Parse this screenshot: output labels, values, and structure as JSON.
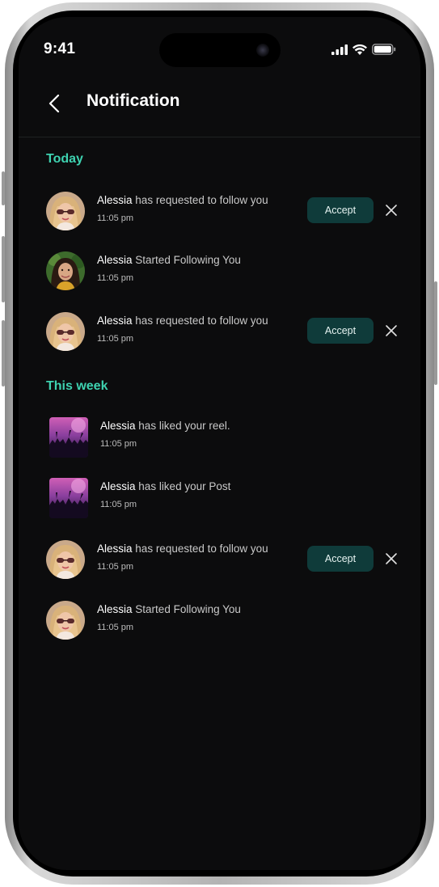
{
  "status_bar": {
    "time": "9:41"
  },
  "header": {
    "title": "Notification"
  },
  "sections": [
    {
      "title": "Today",
      "items": [
        {
          "name": "Alessia",
          "text": "has requested to follow you",
          "time": "11:05 pm",
          "accept_label": "Accept",
          "media": "avatar-blonde"
        },
        {
          "name": "Alessia",
          "text": "Started Following You",
          "time": "11:05 pm",
          "media": "avatar-brunette"
        },
        {
          "name": "Alessia",
          "text": "has requested to follow you",
          "time": "11:05 pm",
          "accept_label": "Accept",
          "media": "avatar-blonde"
        }
      ]
    },
    {
      "title": "This week",
      "items": [
        {
          "name": "Alessia",
          "text": "has liked your reel.",
          "time": "11:05 pm",
          "media": "concert-thumbnail"
        },
        {
          "name": "Alessia",
          "text": "has liked your Post",
          "time": "11:05 pm",
          "media": "concert-thumbnail"
        },
        {
          "name": "Alessia",
          "text": "has requested to follow you",
          "time": "11:05 pm",
          "accept_label": "Accept",
          "media": "avatar-blonde"
        },
        {
          "name": "Alessia",
          "text": "Started Following You",
          "time": "11:05 pm",
          "media": "avatar-blonde"
        }
      ]
    }
  ],
  "colors": {
    "background": "#0c0c0d",
    "accent": "#3ed2b0",
    "accept_button": "#0f3b3a"
  },
  "icons": [
    "back-chevron-icon",
    "signal-icon",
    "wifi-icon",
    "battery-icon",
    "close-icon"
  ]
}
